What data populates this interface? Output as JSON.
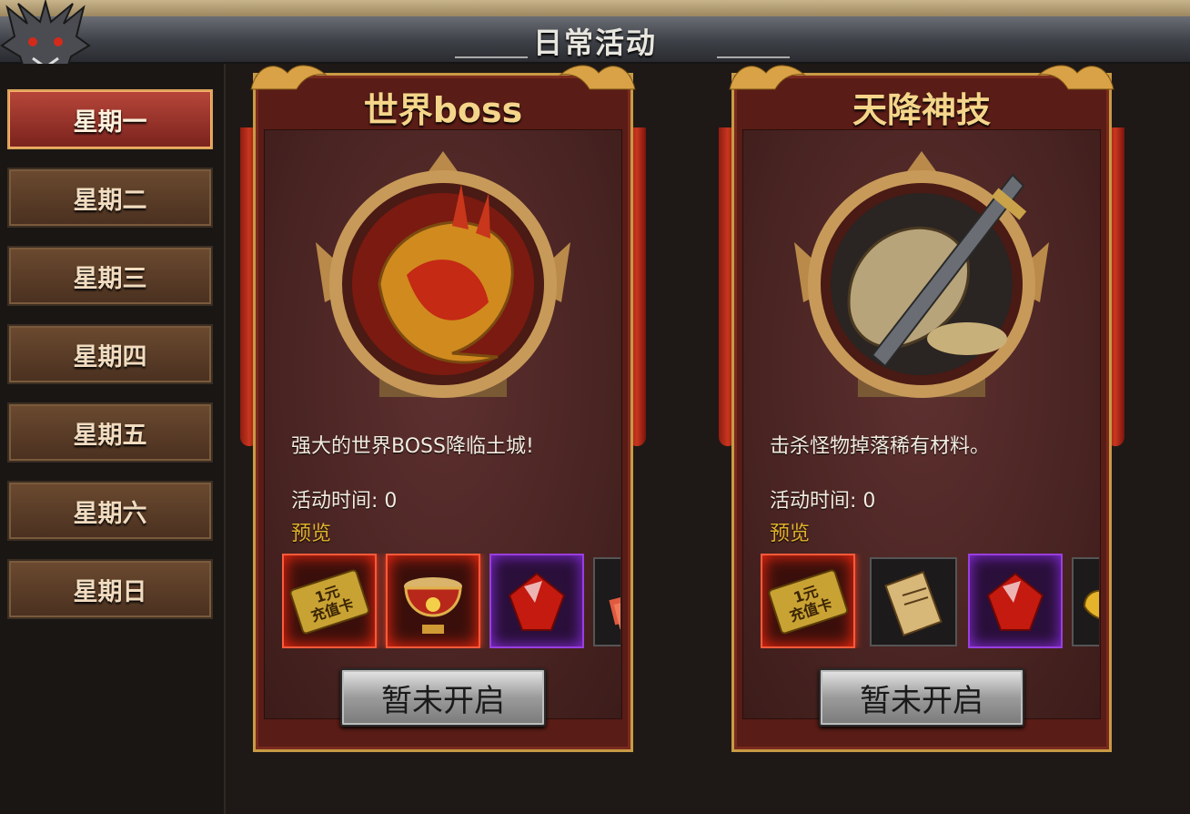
{
  "header": {
    "title": "日常活动"
  },
  "sidebar": {
    "days": [
      {
        "label": "星期一",
        "active": true
      },
      {
        "label": "星期二",
        "active": false
      },
      {
        "label": "星期三",
        "active": false
      },
      {
        "label": "星期四",
        "active": false
      },
      {
        "label": "星期五",
        "active": false
      },
      {
        "label": "星期六",
        "active": false
      },
      {
        "label": "星期日",
        "active": false
      }
    ]
  },
  "activities": [
    {
      "title": "世界boss",
      "description": "强大的世界BOSS降临土城!",
      "time_label": "活动时间: 0",
      "preview_label": "预览",
      "button_label": "暂未开启",
      "rewards": [
        {
          "icon": "recharge-card-icon",
          "text": "1元\n充值卡",
          "frame": "red"
        },
        {
          "icon": "treasure-cauldron-icon",
          "frame": "red"
        },
        {
          "icon": "red-gem-icon",
          "frame": "purple"
        },
        {
          "icon": "red-scroll-bundle-icon",
          "frame": "plain"
        }
      ]
    },
    {
      "title": "天降神技",
      "description": "击杀怪物掉落稀有材料。",
      "time_label": "活动时间: 0",
      "preview_label": "预览",
      "button_label": "暂未开启",
      "rewards": [
        {
          "icon": "recharge-card-icon",
          "text": "1元\n充值卡",
          "frame": "red"
        },
        {
          "icon": "skill-scroll-icon",
          "frame": "plain"
        },
        {
          "icon": "red-gem-icon",
          "frame": "purple"
        },
        {
          "icon": "gold-ingot-icon",
          "frame": "plain"
        }
      ]
    }
  ],
  "colors": {
    "accent_gold": "#f4d58a",
    "panel_red": "#5a1c16",
    "active_tab": "#b8463a"
  }
}
